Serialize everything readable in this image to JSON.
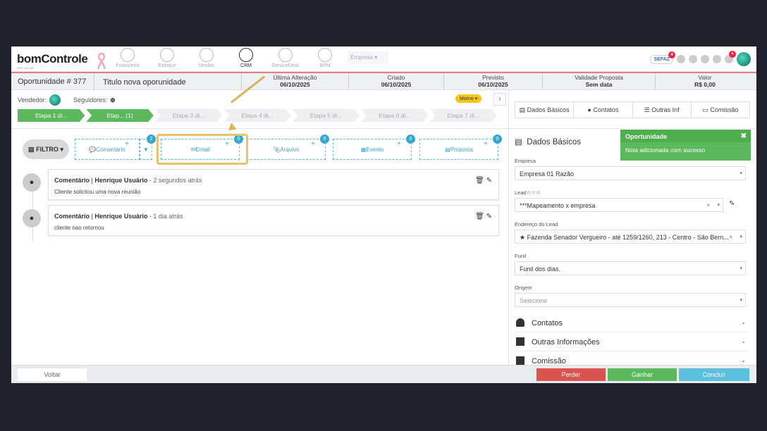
{
  "brand": {
    "name": "bomControle",
    "sub": "ERP ONLINE"
  },
  "nav": [
    {
      "label": "Financeiro",
      "icon": "dollar-icon"
    },
    {
      "label": "Estoque",
      "icon": "box-icon"
    },
    {
      "label": "Vendas",
      "icon": "cart-icon"
    },
    {
      "label": "CRM",
      "icon": "target-icon"
    },
    {
      "label": "ServiceDesk",
      "icon": "headset-icon"
    },
    {
      "label": "BPM",
      "icon": "flow-icon"
    }
  ],
  "empresa_select": "Empresa",
  "top_right": {
    "sefaz": "SEFAZ",
    "sefaz_count": "4",
    "notif_count": "4"
  },
  "infobar": {
    "op_label": "Oportunidade # 377",
    "title": "Titulo nova oporunidade",
    "ultima_label": "Última Alteração",
    "ultima_value": "06/10/2025",
    "criado_label": "Criado",
    "criado_value": "06/10/2025",
    "previsto_label": "Previsto",
    "previsto_value": "06/10/2025",
    "validade_label": "Validade Proposta",
    "validade_value": "Sem data",
    "valor_label": "Valor",
    "valor_value": "R$ 0,00"
  },
  "vendedor_label": "Vendedor:",
  "seguidores_label": "Seguidores:",
  "temperature": "Morno",
  "steps": [
    {
      "label": "Etapa 1 di...",
      "done": true
    },
    {
      "label": "Etap... (1)",
      "done": true
    },
    {
      "label": "Etapa 3 di...",
      "done": false
    },
    {
      "label": "Etapa 4 di...",
      "done": false
    },
    {
      "label": "Etapa 5 di...",
      "done": false
    },
    {
      "label": "Etapa 6 di...",
      "done": false
    },
    {
      "label": "Etapa 7 di...",
      "done": false
    }
  ],
  "filter_label": "FILTRO",
  "actions": {
    "comentario": "Comentário",
    "comentario_count": "2",
    "email": "Email",
    "email_count": "0",
    "arquivo": "Arquivo",
    "arquivo_count": "0",
    "evento": "Evento",
    "evento_count": "0",
    "proposta": "Proposta",
    "proposta_count": "0"
  },
  "timeline": [
    {
      "type": "Comentário",
      "sep": "|",
      "author": "Henrique Usuário",
      "ago": "- 2 segundos atrás",
      "text": "Cliente solicitou uma nova reunião"
    },
    {
      "type": "Comentário",
      "sep": "|",
      "author": "Henrique Usuário",
      "ago": "- 1 dia atrás",
      "text": "cliente nao retornou"
    }
  ],
  "tabs": [
    "Dados Básicos",
    "Contatos",
    "Outras Inf",
    "Comissão"
  ],
  "section_title": "Dados Básicos",
  "fields": {
    "empresa_label": "Empresa",
    "empresa_value": "Empresa 01 Razão",
    "lead_label": "Lead☆☆☆",
    "lead_value": "***Mapeamento x empresa",
    "endereco_label": "Endereço do Lead",
    "endereco_value": "★ Fazenda Senador Vergueiro - até 1259/1260, 213 - Centro - São Bern...",
    "funil_label": "Funil",
    "funil_value": "Funil dos dias.",
    "origem_label": "Origem",
    "origem_placeholder": "Selecione"
  },
  "accordions": [
    "Contatos",
    "Outras Informações",
    "Comissão"
  ],
  "toast": {
    "title": "Oportunidade",
    "message": "Nota adicionada com sucesso",
    "close": "✖"
  },
  "footer": {
    "voltar": "Voltar",
    "perder": "Perder",
    "ganhar": "Ganhar",
    "concluir": "Concluir"
  }
}
